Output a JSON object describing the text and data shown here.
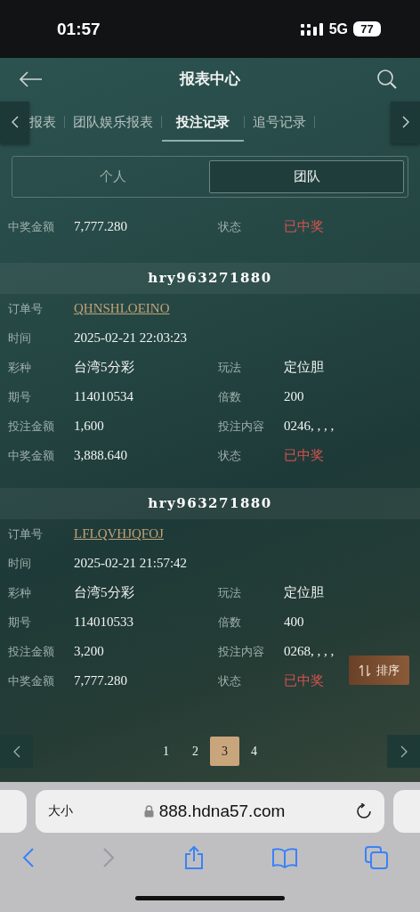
{
  "status_bar": {
    "time": "01:57",
    "network": "5G",
    "battery": "77"
  },
  "header": {
    "title": "报表中心"
  },
  "tabs": [
    {
      "label": "报表",
      "selected": false
    },
    {
      "label": "团队娱乐报表",
      "selected": false
    },
    {
      "label": "投注记录",
      "selected": true
    },
    {
      "label": "追号记录",
      "selected": false
    }
  ],
  "segments": [
    {
      "label": "个人",
      "selected": false
    },
    {
      "label": "团队",
      "selected": true
    }
  ],
  "records": [
    {
      "fields": [
        {
          "label": "中奖金额",
          "value": "7,777.280",
          "kind": "text"
        },
        {
          "label": "状态",
          "value": "已中奖",
          "kind": "status"
        }
      ]
    },
    {
      "user": "hry963271880",
      "fields": [
        {
          "label": "订单号",
          "value": "QHNSHLOEINO",
          "kind": "link"
        },
        {
          "label": "时间",
          "value": "2025-02-21 22:03:23",
          "kind": "wide"
        },
        {
          "label": "彩种",
          "value": "台湾5分彩",
          "kind": "text"
        },
        {
          "label": "玩法",
          "value": "定位胆",
          "kind": "text"
        },
        {
          "label": "期号",
          "value": "114010534",
          "kind": "text"
        },
        {
          "label": "倍数",
          "value": "200",
          "kind": "text"
        },
        {
          "label": "投注金额",
          "value": "1,600",
          "kind": "text"
        },
        {
          "label": "投注内容",
          "value": "0246, , , ,",
          "kind": "text"
        },
        {
          "label": "中奖金额",
          "value": "3,888.640",
          "kind": "text"
        },
        {
          "label": "状态",
          "value": "已中奖",
          "kind": "status"
        }
      ]
    },
    {
      "user": "hry963271880",
      "fields": [
        {
          "label": "订单号",
          "value": "LFLQVHJQFOJ",
          "kind": "link"
        },
        {
          "label": "时间",
          "value": "2025-02-21 21:57:42",
          "kind": "wide"
        },
        {
          "label": "彩种",
          "value": "台湾5分彩",
          "kind": "text"
        },
        {
          "label": "玩法",
          "value": "定位胆",
          "kind": "text"
        },
        {
          "label": "期号",
          "value": "114010533",
          "kind": "text"
        },
        {
          "label": "倍数",
          "value": "400",
          "kind": "text"
        },
        {
          "label": "投注金额",
          "value": "3,200",
          "kind": "text"
        },
        {
          "label": "投注内容",
          "value": "0268, , , ,",
          "kind": "text"
        },
        {
          "label": "中奖金额",
          "value": "7,777.280",
          "kind": "text"
        },
        {
          "label": "状态",
          "value": "已中奖",
          "kind": "status"
        }
      ]
    }
  ],
  "sort_button": {
    "label": "排序"
  },
  "pagination": [
    {
      "label": "1",
      "selected": false
    },
    {
      "label": "2",
      "selected": false
    },
    {
      "label": "3",
      "selected": true
    },
    {
      "label": "4",
      "selected": false
    }
  ],
  "browser": {
    "text_size": "大小",
    "url": "888.hdna57.com"
  }
}
